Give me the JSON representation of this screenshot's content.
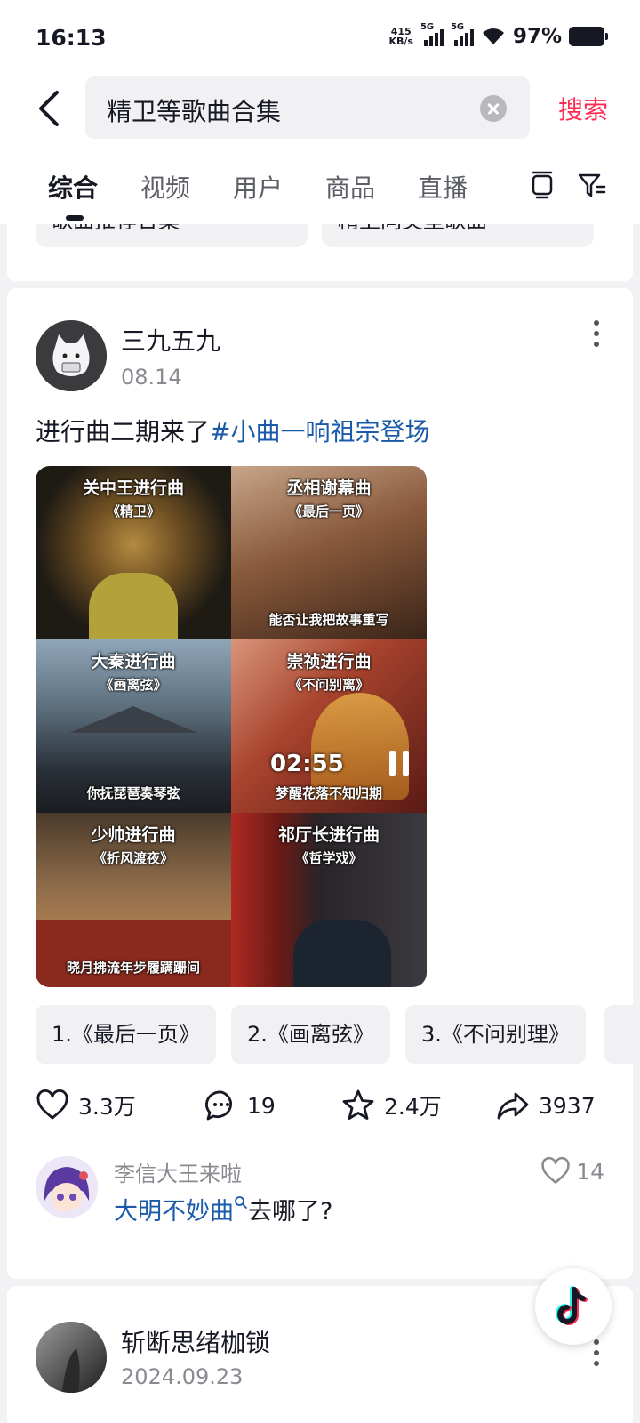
{
  "status_bar": {
    "time": "16:13",
    "net_speed_value": "415",
    "net_speed_unit": "KB/s",
    "signal1_label": "5G",
    "signal2_label": "5G",
    "battery": "97%"
  },
  "search": {
    "query": "精卫等歌曲合集",
    "submit_label": "搜索"
  },
  "tabs": [
    {
      "label": "综合",
      "active": true
    },
    {
      "label": "视频",
      "active": false
    },
    {
      "label": "用户",
      "active": false
    },
    {
      "label": "商品",
      "active": false
    },
    {
      "label": "直播",
      "active": false
    }
  ],
  "partial_chips": [
    "歌曲推荐合集",
    "精卫同类型歌曲"
  ],
  "post": {
    "author": "三九五九",
    "date": "08.14",
    "caption_text": "进行曲二期来了",
    "caption_hashtag": "#小曲一响祖宗登场",
    "tiles": [
      {
        "title": "关中王进行曲",
        "subtitle": "《精卫》",
        "bottom": ""
      },
      {
        "title": "丞相谢幕曲",
        "subtitle": "《最后一页》",
        "bottom": "能否让我把故事重写"
      },
      {
        "title": "大秦进行曲",
        "subtitle": "《画离弦》",
        "bottom": "你抚琵琶奏琴弦"
      },
      {
        "title": "崇祯进行曲",
        "subtitle": "《不问别离》",
        "bottom": "梦醒花落不知归期"
      },
      {
        "title": "少帅进行曲",
        "subtitle": "《折风渡夜》",
        "bottom": "晓月拂流年步履蹒跚间"
      },
      {
        "title": "祁厅长进行曲",
        "subtitle": "《哲学戏》",
        "bottom": ""
      }
    ],
    "duration": "02:55",
    "chips": [
      "1.《最后一页》",
      "2.《画离弦》",
      "3.《不问别理》"
    ],
    "likes": "3.3万",
    "comments": "19",
    "favorites": "2.4万",
    "shares": "3937",
    "top_comment": {
      "user": "李信大王来啦",
      "link_text": "大明不妙曲",
      "text_after": "去哪了?",
      "likes": "14"
    }
  },
  "post2": {
    "author": "斩断思绪枷锁",
    "date": "2024.09.23"
  }
}
